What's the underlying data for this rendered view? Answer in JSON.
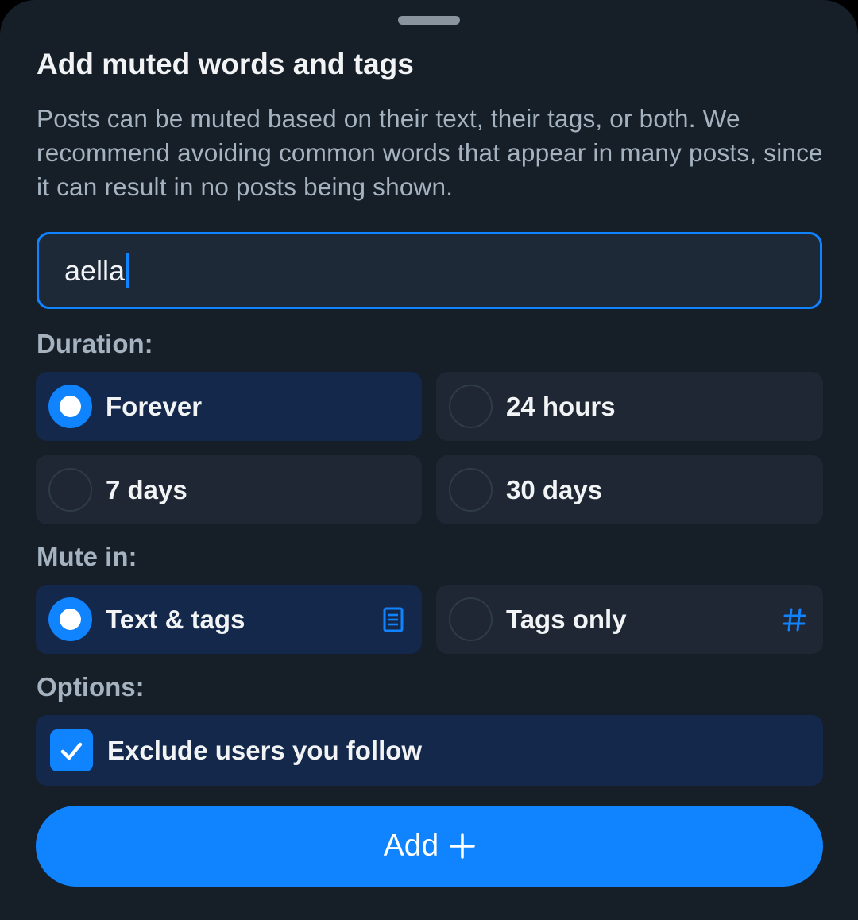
{
  "sheet": {
    "title": "Add muted words and tags",
    "description": "Posts can be muted based on their text, their tags, or both. We recommend avoiding common words that appear in many posts, since it can result in no posts being shown."
  },
  "input": {
    "value": "aella"
  },
  "duration": {
    "label": "Duration:",
    "options": [
      {
        "label": "Forever",
        "selected": true
      },
      {
        "label": "24 hours",
        "selected": false
      },
      {
        "label": "7 days",
        "selected": false
      },
      {
        "label": "30 days",
        "selected": false
      }
    ]
  },
  "mute_in": {
    "label": "Mute in:",
    "options": [
      {
        "label": "Text & tags",
        "selected": true,
        "icon": "document-icon"
      },
      {
        "label": "Tags only",
        "selected": false,
        "icon": "hashtag-icon"
      }
    ]
  },
  "options": {
    "label": "Options:",
    "exclude_following": {
      "label": "Exclude users you follow",
      "checked": true
    }
  },
  "add_button": {
    "label": "Add",
    "icon": "plus-icon"
  },
  "colors": {
    "accent": "#1083fe",
    "background": "#161e27",
    "selected_option": "#13284a",
    "option": "#1e2733"
  }
}
